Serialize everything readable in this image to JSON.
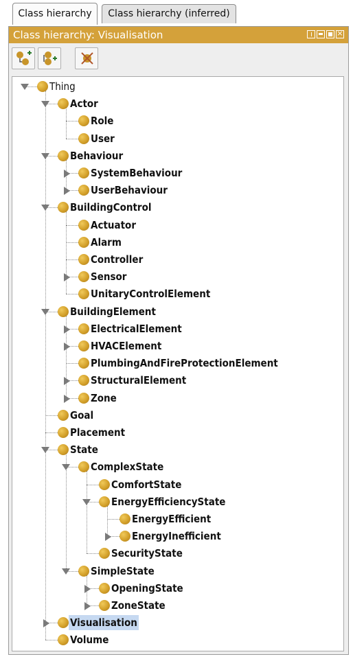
{
  "tabs": [
    {
      "label": "Class hierarchy"
    },
    {
      "label": "Class hierarchy (inferred)"
    }
  ],
  "panel": {
    "title": "Class hierarchy: Visualisation",
    "window_buttons": [
      "float-icon",
      "minimize-icon",
      "maximize-icon",
      "close-icon"
    ]
  },
  "toolbar": {
    "buttons": [
      {
        "icon": "add-subclass-icon"
      },
      {
        "icon": "add-sibling-class-icon"
      },
      {
        "icon": "delete-class-icon"
      }
    ]
  },
  "colors": {
    "title_bar": "#d4a13a",
    "class_dot": "#d3a02a",
    "selection": "#c6d9f1"
  },
  "tree": [
    {
      "label": "Thing",
      "depth": 0,
      "toggle": "expanded"
    },
    {
      "label": "Actor",
      "depth": 1,
      "toggle": "expanded"
    },
    {
      "label": "Role",
      "depth": 2,
      "toggle": "none"
    },
    {
      "label": "User",
      "depth": 2,
      "toggle": "none"
    },
    {
      "label": "Behaviour",
      "depth": 1,
      "toggle": "expanded"
    },
    {
      "label": "SystemBehaviour",
      "depth": 2,
      "toggle": "collapsed"
    },
    {
      "label": "UserBehaviour",
      "depth": 2,
      "toggle": "collapsed"
    },
    {
      "label": "BuildingControl",
      "depth": 1,
      "toggle": "expanded"
    },
    {
      "label": "Actuator",
      "depth": 2,
      "toggle": "none"
    },
    {
      "label": "Alarm",
      "depth": 2,
      "toggle": "none"
    },
    {
      "label": "Controller",
      "depth": 2,
      "toggle": "none"
    },
    {
      "label": "Sensor",
      "depth": 2,
      "toggle": "collapsed"
    },
    {
      "label": "UnitaryControlElement",
      "depth": 2,
      "toggle": "none"
    },
    {
      "label": "BuildingElement",
      "depth": 1,
      "toggle": "expanded"
    },
    {
      "label": "ElectricalElement",
      "depth": 2,
      "toggle": "collapsed"
    },
    {
      "label": "HVACElement",
      "depth": 2,
      "toggle": "collapsed"
    },
    {
      "label": "PlumbingAndFireProtectionElement",
      "depth": 2,
      "toggle": "none"
    },
    {
      "label": "StructuralElement",
      "depth": 2,
      "toggle": "collapsed"
    },
    {
      "label": "Zone",
      "depth": 2,
      "toggle": "collapsed"
    },
    {
      "label": "Goal",
      "depth": 1,
      "toggle": "none"
    },
    {
      "label": "Placement",
      "depth": 1,
      "toggle": "none"
    },
    {
      "label": "State",
      "depth": 1,
      "toggle": "expanded"
    },
    {
      "label": "ComplexState",
      "depth": 2,
      "toggle": "expanded"
    },
    {
      "label": "ComfortState",
      "depth": 3,
      "toggle": "none"
    },
    {
      "label": "EnergyEfficiencyState",
      "depth": 3,
      "toggle": "expanded"
    },
    {
      "label": "EnergyEfficient",
      "depth": 4,
      "toggle": "none"
    },
    {
      "label": "EnergyInefficient",
      "depth": 4,
      "toggle": "collapsed"
    },
    {
      "label": "SecurityState",
      "depth": 3,
      "toggle": "none"
    },
    {
      "label": "SimpleState",
      "depth": 2,
      "toggle": "expanded"
    },
    {
      "label": "OpeningState",
      "depth": 3,
      "toggle": "collapsed"
    },
    {
      "label": "ZoneState",
      "depth": 3,
      "toggle": "collapsed"
    },
    {
      "label": "Visualisation",
      "depth": 1,
      "toggle": "collapsed",
      "selected": true
    },
    {
      "label": "Volume",
      "depth": 1,
      "toggle": "none"
    }
  ]
}
